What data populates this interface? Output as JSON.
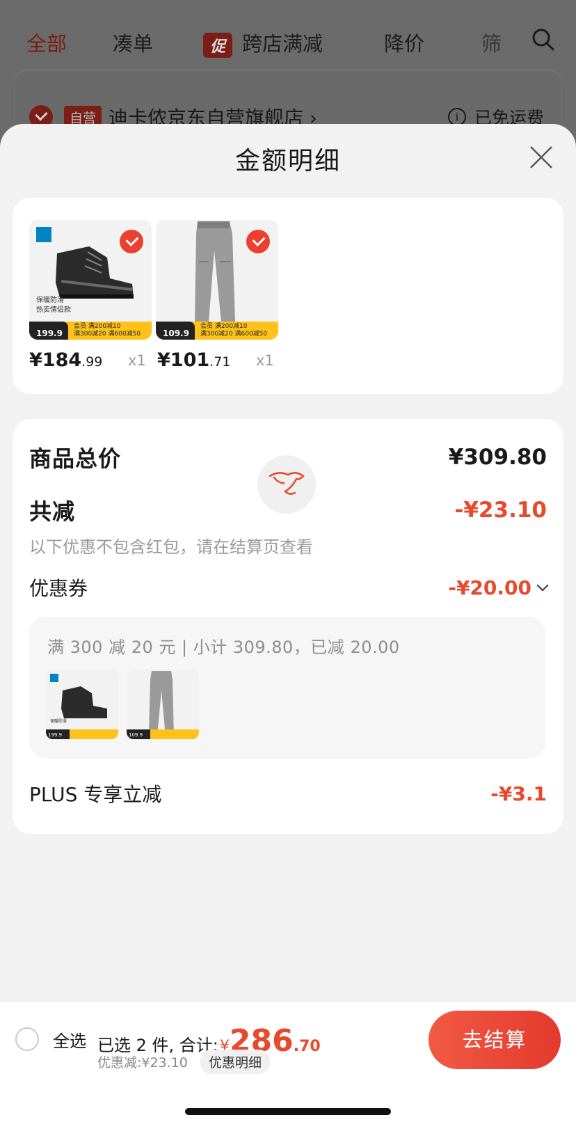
{
  "background_page": {
    "tabs": [
      {
        "label": "全部",
        "active": true
      },
      {
        "label": "凑单"
      },
      {
        "label": "跨店满减",
        "tag": "促"
      },
      {
        "label": "降价"
      },
      {
        "label": "筛"
      }
    ],
    "shop": {
      "self_tag": "自营",
      "name": "迪卡侬京东自营旗舰店 ›",
      "shipping": "已免运费"
    }
  },
  "sheet": {
    "title": "金额明细",
    "products": [
      {
        "name_icon": "hiking-boot",
        "img_caption": "保暖防滑\n热卖情侣款",
        "banner_price": "199.9",
        "banner_promo_1": "会员 满200减10",
        "banner_promo_2": "满300减20 满600减50",
        "price_int": "¥184",
        "price_dec": ".99",
        "qty": "x1"
      },
      {
        "name_icon": "hiking-pants",
        "img_caption": "",
        "banner_price": "109.9",
        "banner_promo_1": "会员 满200减10",
        "banner_promo_2": "满300减20 满600减50",
        "price_int": "¥101",
        "price_dec": ".71",
        "qty": "x1"
      }
    ],
    "summary": {
      "total_label": "商品总价",
      "total_value": "¥309.80",
      "reduce_label": "共减",
      "reduce_value": "-¥23.10",
      "reduce_note": "以下优惠不包含红包，请在结算页查看",
      "coupon_label": "优惠券",
      "coupon_value": "-¥20.00",
      "coupon_detail": "满 300 减 20 元 | 小计 309.80，已减 20.00",
      "plus_label": "PLUS 专享立减",
      "plus_value": "-¥3.1"
    }
  },
  "bottom_bar": {
    "select_all": "全选",
    "selected_text": "已选 2 件, 合计:",
    "currency": "¥",
    "total_int": "286",
    "total_dec": ".70",
    "discount_text": "优惠减:¥23.10",
    "detail_pill": "优惠明细",
    "checkout": "去结算"
  },
  "colors": {
    "accent_red": "#e8482c",
    "checkout_red": "#e23a2e",
    "banner_yellow": "#ffc21a"
  }
}
